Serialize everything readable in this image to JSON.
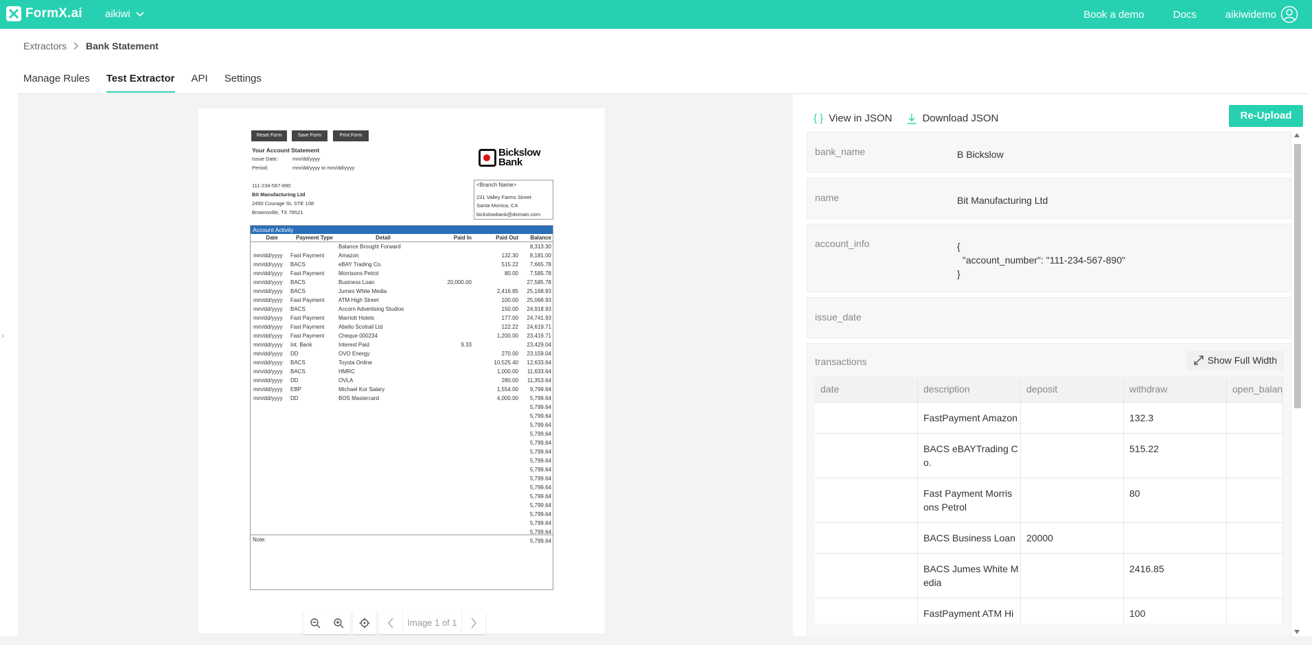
{
  "app": {
    "logo_text": "FormX.ai",
    "workspace": "aikiwi"
  },
  "topnav": {
    "book_demo": "Book a demo",
    "docs": "Docs",
    "username": "aikiwidemo"
  },
  "breadcrumb": {
    "root": "Extractors",
    "current": "Bank Statement"
  },
  "tabs": [
    {
      "label": "Manage Rules"
    },
    {
      "label": "Test Extractor"
    },
    {
      "label": "API"
    },
    {
      "label": "Settings"
    }
  ],
  "document": {
    "buttons": [
      "Reset Form",
      "Save Form",
      "Print Form"
    ],
    "title": "Your Account Statement",
    "issue_date_label": "Issue Date:",
    "issue_date_value": "mm/dd/yyyy",
    "period_label": "Period:",
    "period_value": "mm/dd/yyyy to mm/dd/yyyy",
    "bank_name_line1": "Bickslow",
    "bank_name_line2": "Bank",
    "account_number": "111-234-567-890",
    "company": "Bit Manufacturing Ltd",
    "address1": "2450 Courage St, STE 108",
    "address2": "Brownsville, TX 78521",
    "branch_name": "<Branch Name>",
    "branch_addr1": "231 Valley Farms Street",
    "branch_addr2": "Santa Monica, CA",
    "branch_email": "bickslowbank@domain.com",
    "activity_title": "Account Activity",
    "columns": [
      "Date",
      "Payment Type",
      "Detail",
      "Paid In",
      "Paid Out",
      "Balance"
    ],
    "rows": [
      [
        "",
        "",
        "Balance Brought Forward",
        "",
        "",
        "8,313.30"
      ],
      [
        "mm/dd/yyyy",
        "Fast Payment",
        "Amazon",
        "",
        "132.30",
        "8,181.00"
      ],
      [
        "mm/dd/yyyy",
        "BACS",
        "eBAY Trading Co.",
        "",
        "515.22",
        "7,665.78"
      ],
      [
        "mm/dd/yyyy",
        "Fast Payment",
        "Morrisons Petrol",
        "",
        "80.00",
        "7,585.78"
      ],
      [
        "mm/dd/yyyy",
        "BACS",
        "Business Loan",
        "20,000.00",
        "",
        "27,585.78"
      ],
      [
        "mm/dd/yyyy",
        "BACS",
        "Jumes White Media",
        "",
        "2,416.85",
        "25,168.93"
      ],
      [
        "mm/dd/yyyy",
        "Fast Payment",
        "ATM High Street",
        "",
        "100.00",
        "25,068.93"
      ],
      [
        "mm/dd/yyyy",
        "BACS",
        "Accorn Advertising Studios",
        "",
        "150.00",
        "24,918.93"
      ],
      [
        "mm/dd/yyyy",
        "Fast Payment",
        "Marriott Hotels",
        "",
        "177.00",
        "24,741.93"
      ],
      [
        "mm/dd/yyyy",
        "Fast Payment",
        "Abelio Scotrail Ltd",
        "",
        "122.22",
        "24,619.71"
      ],
      [
        "mm/dd/yyyy",
        "Fast Payment",
        "Cheque 000234",
        "",
        "1,200.00",
        "23,419.71"
      ],
      [
        "mm/dd/yyyy",
        "Int. Bank",
        "Interest Paid",
        "9.33",
        "",
        "23,429.04"
      ],
      [
        "mm/dd/yyyy",
        "DD",
        "OVO Energy",
        "",
        "270.00",
        "23,159.04"
      ],
      [
        "mm/dd/yyyy",
        "BACS",
        "Toyota Online",
        "",
        "10,525.40",
        "12,633.64"
      ],
      [
        "mm/dd/yyyy",
        "BACS",
        "HMRC",
        "",
        "1,000.00",
        "11,633.64"
      ],
      [
        "mm/dd/yyyy",
        "DD",
        "OVLA",
        "",
        "280.00",
        "11,353.64"
      ],
      [
        "mm/dd/yyyy",
        "EBP",
        "Michael Kor Salary",
        "",
        "1,554.00",
        "9,799.64"
      ],
      [
        "mm/dd/yyyy",
        "DD",
        "BOS Mastercard",
        "",
        "4,000.00",
        "5,799.64"
      ],
      [
        "",
        "",
        "",
        "",
        "",
        "5,799.64"
      ],
      [
        "",
        "",
        "",
        "",
        "",
        "5,799.64"
      ],
      [
        "",
        "",
        "",
        "",
        "",
        "5,799.64"
      ],
      [
        "",
        "",
        "",
        "",
        "",
        "5,799.64"
      ],
      [
        "",
        "",
        "",
        "",
        "",
        "5,799.64"
      ],
      [
        "",
        "",
        "",
        "",
        "",
        "5,799.64"
      ],
      [
        "",
        "",
        "",
        "",
        "",
        "5,799.64"
      ],
      [
        "",
        "",
        "",
        "",
        "",
        "5,799.64"
      ],
      [
        "",
        "",
        "",
        "",
        "",
        "5,799.64"
      ],
      [
        "",
        "",
        "",
        "",
        "",
        "5,799.64"
      ],
      [
        "",
        "",
        "",
        "",
        "",
        "5,799.64"
      ],
      [
        "",
        "",
        "",
        "",
        "",
        "5,799.64"
      ],
      [
        "",
        "",
        "",
        "",
        "",
        "5,799.64"
      ],
      [
        "",
        "",
        "",
        "",
        "",
        "5,799.64"
      ],
      [
        "",
        "",
        "",
        "",
        "",
        "5,799.64"
      ],
      [
        "",
        "",
        "",
        "",
        "",
        "5,799.64"
      ]
    ],
    "note_label": "Note:"
  },
  "viewer": {
    "page_label": "Image 1 of 1"
  },
  "results": {
    "view_json": "View in JSON",
    "download_json": "Download JSON",
    "reupload": "Re-Upload",
    "fields": [
      {
        "key": "bank_name",
        "value": "B Bickslow"
      },
      {
        "key": "name",
        "value": "Bit Manufacturing Ltd"
      },
      {
        "key": "account_info",
        "value": "{\n  \"account_number\": \"111-234-567-890\"\n}"
      },
      {
        "key": "issue_date",
        "value": ""
      }
    ],
    "transactions": {
      "key": "transactions",
      "show_full_width": "Show Full Width",
      "columns": [
        "date",
        "description",
        "deposit",
        "withdraw",
        "open_balance"
      ],
      "rows": [
        [
          "",
          "FastPayment Amazon",
          "",
          "132.3",
          ""
        ],
        [
          "",
          "BACS eBAYTrading C\no.",
          "",
          "515.22",
          ""
        ],
        [
          "",
          "Fast Payment Morris\nons Petrol",
          "",
          "80",
          ""
        ],
        [
          "",
          "BACS Business Loan",
          "20000",
          "",
          ""
        ],
        [
          "",
          "BACS Jumes White M\nedia",
          "",
          "2416.85",
          ""
        ],
        [
          "",
          "FastPayment ATM Hi\ngh Street",
          "",
          "100",
          ""
        ],
        [
          "",
          "",
          "",
          "",
          ""
        ]
      ]
    }
  }
}
